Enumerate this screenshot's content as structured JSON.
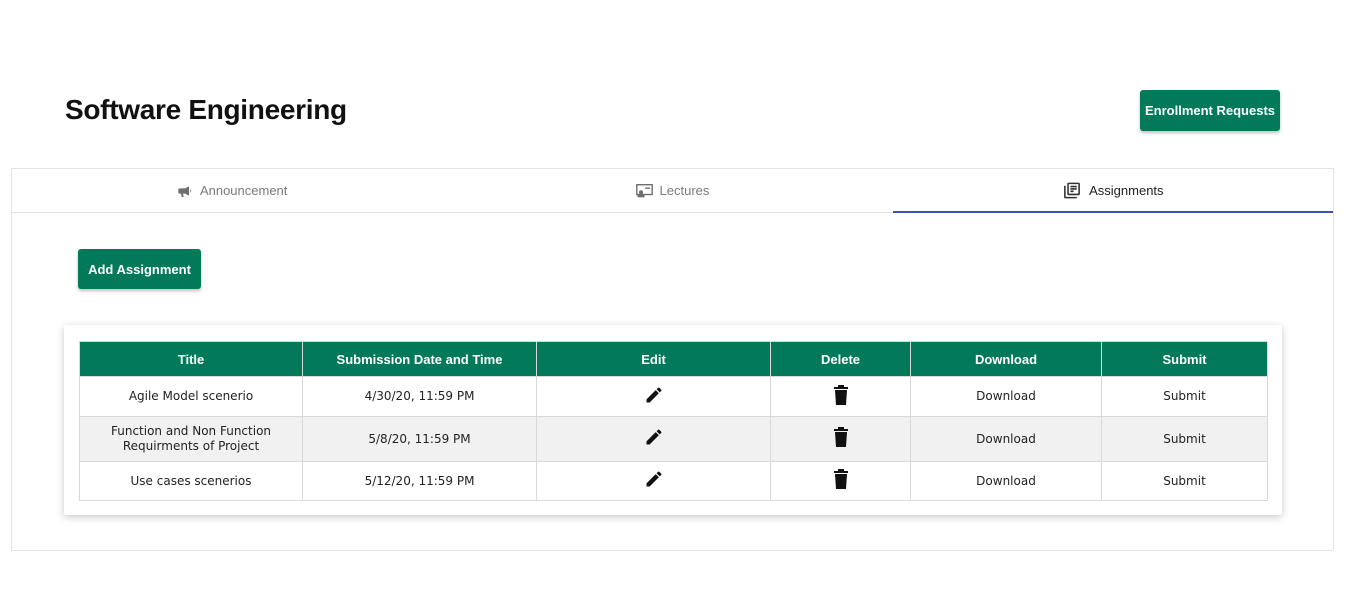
{
  "header": {
    "title": "Software Engineering",
    "enroll_label": "Enrollment Requests"
  },
  "tabs": [
    {
      "label": "Announcement",
      "icon": "megaphone-icon",
      "active": false
    },
    {
      "label": "Lectures",
      "icon": "presentation-icon",
      "active": false
    },
    {
      "label": "Assignments",
      "icon": "library-books-icon",
      "active": true
    }
  ],
  "actions": {
    "add_label": "Add Assignment"
  },
  "table": {
    "columns": [
      "Title",
      "Submission Date and Time",
      "Edit",
      "Delete",
      "Download",
      "Submit"
    ],
    "rows": [
      {
        "title": "Agile Model scenerio",
        "date": "4/30/20, 11:59 PM",
        "download": "Download",
        "submit": "Submit"
      },
      {
        "title": "Function and Non Function Requirments of Project",
        "date": "5/8/20, 11:59 PM",
        "download": "Download",
        "submit": "Submit"
      },
      {
        "title": "Use cases scenerios",
        "date": "5/12/20, 11:59 PM",
        "download": "Download",
        "submit": "Submit"
      }
    ]
  },
  "colors": {
    "accent_green": "#027a59",
    "tab_indicator": "#3f51b5"
  }
}
